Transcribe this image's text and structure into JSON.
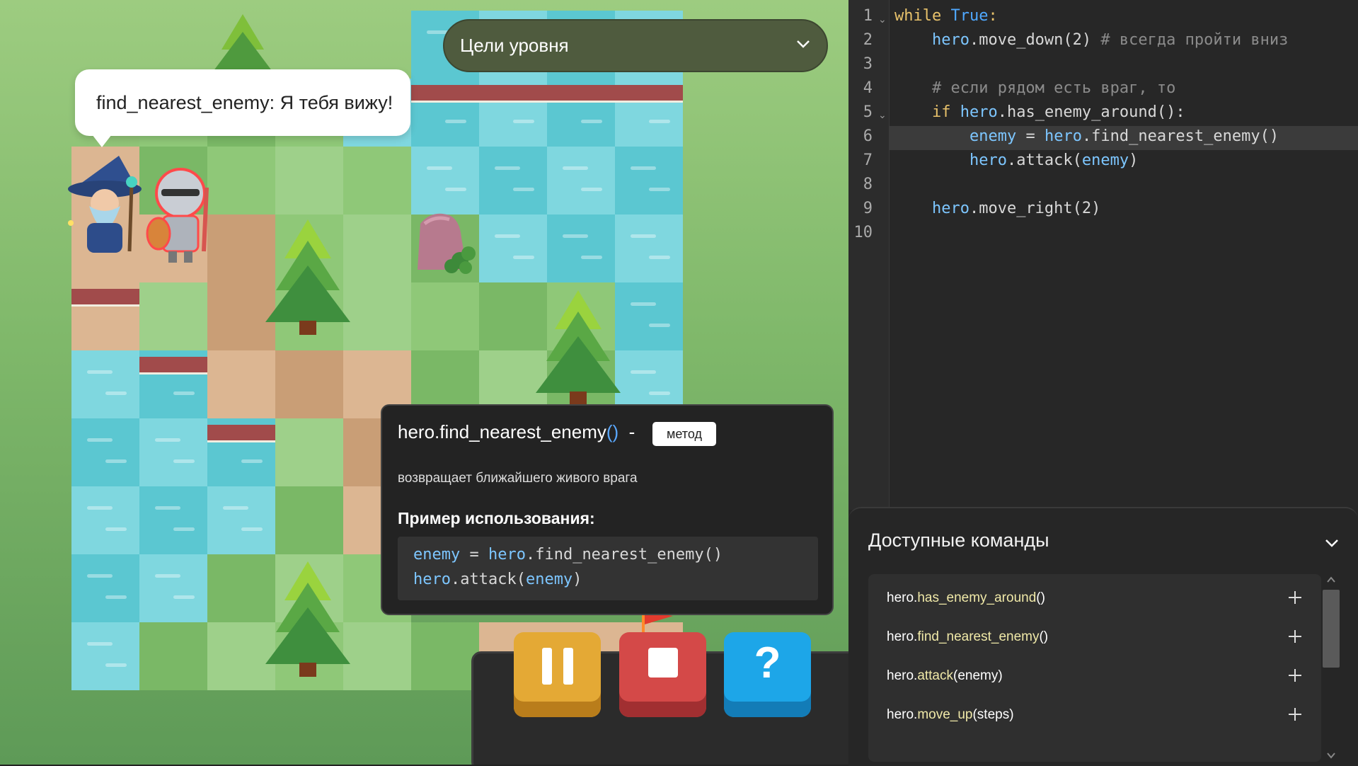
{
  "speech": {
    "text": "find_nearest_enemy: Я тебя вижу!"
  },
  "goals": {
    "label": "Цели уровня"
  },
  "tooltip": {
    "method": "hero.find_nearest_enemy",
    "parens": "()",
    "dash": "-",
    "badge": "метод",
    "description": "возвращает ближайшего живого врага",
    "example_label": "Пример использования:",
    "example_line1": {
      "var": "enemy",
      "op": " = ",
      "obj": "hero",
      "rest": ".find_nearest_enemy()"
    },
    "example_line2": {
      "obj": "hero",
      "mid": ".attack(",
      "var": "enemy",
      "end": ")"
    }
  },
  "controls": {
    "help_label": "?",
    "colors": {
      "pause": "#e4a935",
      "stop": "#d44948",
      "help": "#1da6e8"
    }
  },
  "editor": {
    "line_numbers": [
      "1",
      "2",
      "3",
      "4",
      "5",
      "6",
      "7",
      "8",
      "9",
      "10"
    ],
    "l1": {
      "kw": "while",
      "val": "True",
      "colon": ":"
    },
    "l2": {
      "obj": "hero",
      "call": ".move_down(2)",
      "comment": "# всегда пройти вниз"
    },
    "l4": {
      "comment": "# если рядом есть враг, то"
    },
    "l5": {
      "kw": "if",
      "obj": "hero",
      "call": ".has_enemy_around():"
    },
    "l6": {
      "var": "enemy",
      "op": " = ",
      "obj": "hero",
      "call": ".find_nearest_enemy()"
    },
    "l7": {
      "obj": "hero",
      "call": ".attack(",
      "var": "enemy",
      "end": ")"
    },
    "l9": {
      "obj": "hero",
      "call": ".move_right(2)"
    }
  },
  "commands": {
    "title": "Доступные команды",
    "items": [
      {
        "obj": "hero.",
        "method": "has_enemy_around",
        "args": "()"
      },
      {
        "obj": "hero.",
        "method": "find_nearest_enemy",
        "args": "()"
      },
      {
        "obj": "hero.",
        "method": "attack",
        "args": "(enemy)"
      },
      {
        "obj": "hero.",
        "method": "move_up",
        "args": "(steps)"
      }
    ]
  }
}
